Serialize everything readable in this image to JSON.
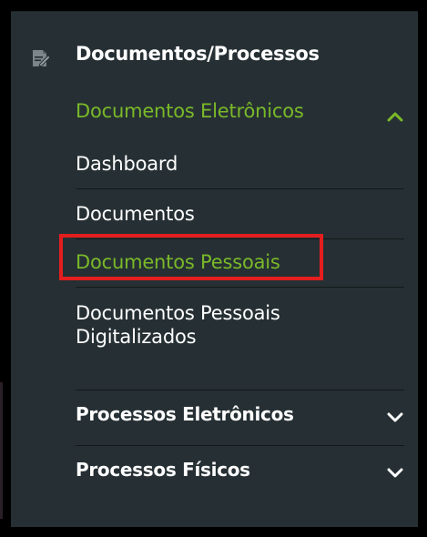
{
  "menu": {
    "section_title": "Documentos/Processos",
    "section_icon": "edit-document-icon",
    "expanded_group": {
      "label": "Documentos Eletrônicos",
      "icon": "chevron-up-icon",
      "items": [
        {
          "label": "Dashboard"
        },
        {
          "label": "Documentos"
        },
        {
          "label": "Documentos Pessoais"
        },
        {
          "label": "Documentos Pessoais Digitalizados"
        }
      ],
      "active_index": 2
    },
    "collapsed_groups": [
      {
        "label": "Processos Eletrônicos",
        "icon": "chevron-down-icon"
      },
      {
        "label": "Processos Físicos",
        "icon": "chevron-down-icon"
      }
    ]
  },
  "colors": {
    "panel_bg": "#263034",
    "accent_green": "#7ab929",
    "text_white": "#ffffff",
    "highlight_red": "#e41e1e"
  }
}
